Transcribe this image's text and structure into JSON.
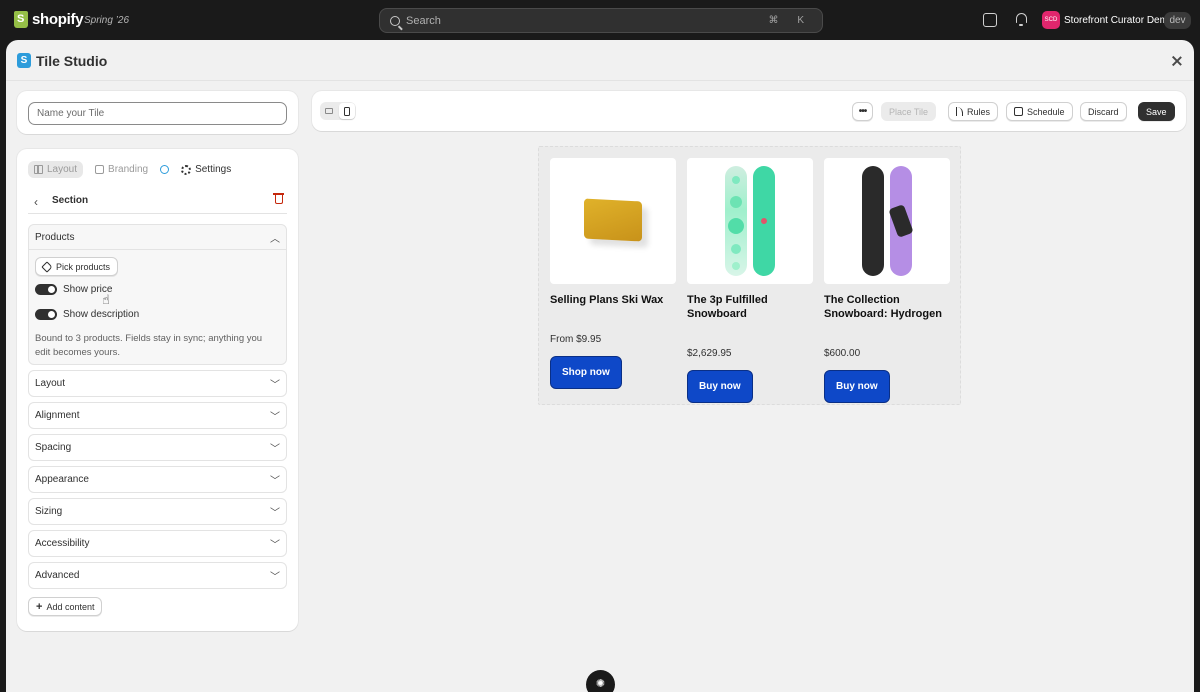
{
  "topbar": {
    "logo_text": "shopify",
    "edition": "Spring ’26",
    "search": {
      "placeholder": "Search",
      "shortcut": "⌘ K"
    },
    "store": {
      "initials": "SCD",
      "name": "Storefront Curator Demo",
      "badge": "dev"
    }
  },
  "modal": {
    "app_icon": "S",
    "title": "Tile Studio"
  },
  "name_field": {
    "placeholder": "Name your Tile",
    "value": ""
  },
  "sidebar": {
    "tabs": [
      {
        "label": "Layout",
        "icon": "layout-grid-icon"
      },
      {
        "label": "Branding",
        "icon": "branding-icon"
      },
      {
        "label": "Settings",
        "icon": "gear-icon"
      }
    ],
    "section": {
      "back": "‹",
      "label": "Section"
    },
    "products_panel": {
      "label": "Products",
      "pick_button": "Pick products",
      "toggles": [
        {
          "label": "Show price",
          "on": true
        },
        {
          "label": "Show description",
          "on": true
        }
      ],
      "note": "Bound to 3 products. Fields stay in sync; anything you edit becomes yours."
    },
    "accordions": [
      "Layout",
      "Alignment",
      "Spacing",
      "Appearance",
      "Sizing",
      "Accessibility",
      "Advanced"
    ],
    "add_content": "Add content"
  },
  "toolbar": {
    "more": "•••",
    "place": "Place Tile",
    "rules": "Rules",
    "schedule": "Schedule",
    "discard": "Discard",
    "save": "Save"
  },
  "products": [
    {
      "name": "Selling Plans Ski Wax",
      "price": "From $9.95",
      "cta": "Shop now"
    },
    {
      "name": "The 3p Fulfilled Snowboard",
      "price": "$2,629.95",
      "cta": "Buy now"
    },
    {
      "name": "The Collection Snowboard: Hydrogen",
      "price": "$600.00",
      "cta": "Buy now"
    }
  ],
  "colors": {
    "accent_button": "#0e48c8",
    "primary_dark": "#303030",
    "danger": "#c5280c",
    "avatar": "#e0266d"
  }
}
